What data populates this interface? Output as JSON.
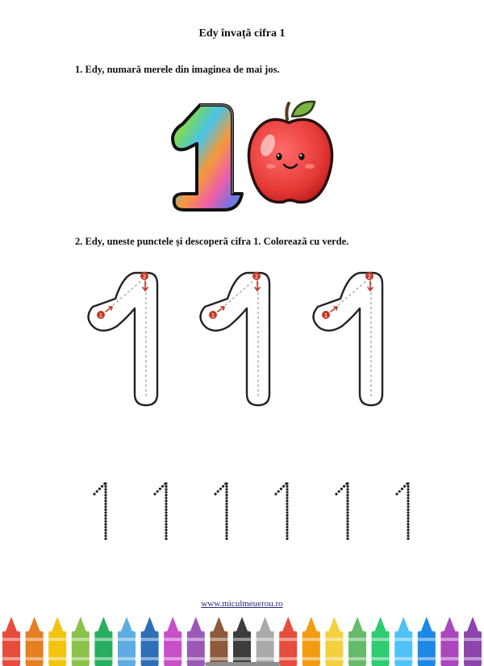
{
  "worksheet": {
    "title": "Edy învață cifra 1",
    "task1": "1. Edy, numară merele din imaginea de mai jos.",
    "task2": "2. Edy, uneste punctele și  descoperă cifra 1. Colorează cu verde.",
    "website": "www.miculmeuerou.ro"
  },
  "trace_steps": [
    "1",
    "2"
  ],
  "dotted_ones_count": 6,
  "crayon_colors": [
    "#e74c3c",
    "#e67e22",
    "#f1c40f",
    "#8bc34a",
    "#27ae60",
    "#5dade2",
    "#2e6fb7",
    "#c84fc8",
    "#9b59b6",
    "#8d5a3b",
    "#3d3d3d",
    "#aaaaaa",
    "#e74c3c",
    "#f39c12",
    "#f4d03f",
    "#66bb6a",
    "#2ecc71",
    "#4fc3f7",
    "#1e88e5",
    "#ab47bc",
    "#8e44ad"
  ],
  "icons": {
    "rainbow_one": "rainbow-digit-one-icon",
    "apple": "apple-icon"
  }
}
